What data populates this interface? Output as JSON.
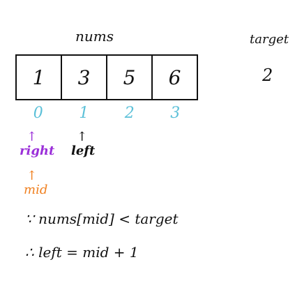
{
  "labels": {
    "array_name": "nums",
    "target_name": "target",
    "target_value": "2"
  },
  "array": {
    "values": [
      "1",
      "3",
      "5",
      "6"
    ],
    "indices": [
      "0",
      "1",
      "2",
      "3"
    ]
  },
  "pointers": {
    "right": {
      "label": "right",
      "arrow": "↑",
      "color": "#9b30d9"
    },
    "left": {
      "label": "left",
      "arrow": "↑",
      "color": "#111111"
    },
    "mid": {
      "label": "mid",
      "arrow": "↑",
      "color": "#f08020"
    }
  },
  "colors": {
    "index": "#5bc0d8",
    "ink": "#111111"
  },
  "statements": {
    "reason": "∵ nums[mid] < target",
    "conclusion": "∴ left = mid + 1"
  }
}
